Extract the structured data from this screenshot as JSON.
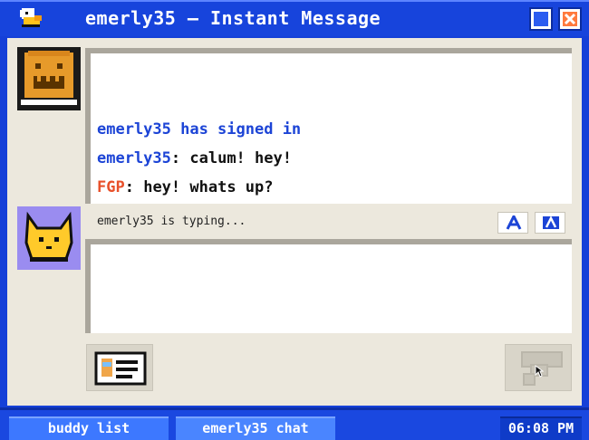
{
  "window": {
    "title": "emerly35 – Instant Message",
    "app_icon": "duck-icon",
    "controls": [
      "minimize-icon",
      "close-icon"
    ]
  },
  "conversation": {
    "messages": [
      {
        "sender": "emerly35",
        "text": "emerly35 has signed in",
        "type": "system",
        "color": "#1c44d6"
      },
      {
        "sender": "emerly35",
        "separator": ":",
        "text": " calum! hey!",
        "color": "#1c44d6"
      },
      {
        "sender": "FGP",
        "separator": ":",
        "text": " hey! whats up?",
        "color": "#e8502a"
      }
    ]
  },
  "status": {
    "typing": "emerly35 is typing..."
  },
  "toolbar": {
    "font_icon": "font-icon",
    "color_icon": "text-color-icon"
  },
  "input": {
    "value": ""
  },
  "buttons": {
    "profile_icon": "profile-card-icon",
    "send_icon": "send-icon"
  },
  "taskbar": {
    "tabs": [
      {
        "label": "buddy list"
      },
      {
        "label": "emerly35 chat"
      }
    ],
    "clock": "06:08 PM"
  },
  "colors": {
    "titlebar": "#1744dc",
    "buddy_name": "#1c44d6",
    "self_name": "#e8502a",
    "client_bg": "#ece8dd"
  }
}
